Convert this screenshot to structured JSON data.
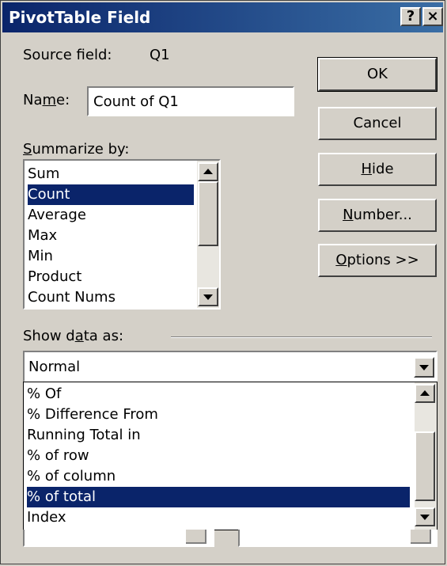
{
  "window": {
    "title": "PivotTable Field",
    "help_glyph": "?",
    "close_glyph": "×"
  },
  "source_field": {
    "label": "Source field:",
    "value": "Q1"
  },
  "name": {
    "label_pre": "Na",
    "label_u": "m",
    "label_post": "e:",
    "value": "Count of Q1"
  },
  "summarize_by": {
    "label_u": "S",
    "label_rest": "ummarize by:",
    "items": [
      "Sum",
      "Count",
      "Average",
      "Max",
      "Min",
      "Product",
      "Count Nums"
    ],
    "selected": "Count"
  },
  "buttons": {
    "ok": "OK",
    "cancel": "Cancel",
    "hide_u": "H",
    "hide_rest": "ide",
    "number_u": "N",
    "number_rest": "umber...",
    "options_u": "O",
    "options_rest": "ptions >>"
  },
  "show_data_as": {
    "label_pre": "Show d",
    "label_u": "a",
    "label_post": "ta as:",
    "value": "Normal",
    "options": [
      "% Of",
      "% Difference From",
      "Running Total in",
      "% of row",
      "% of column",
      "% of total",
      "Index"
    ],
    "highlighted": "% of total"
  }
}
